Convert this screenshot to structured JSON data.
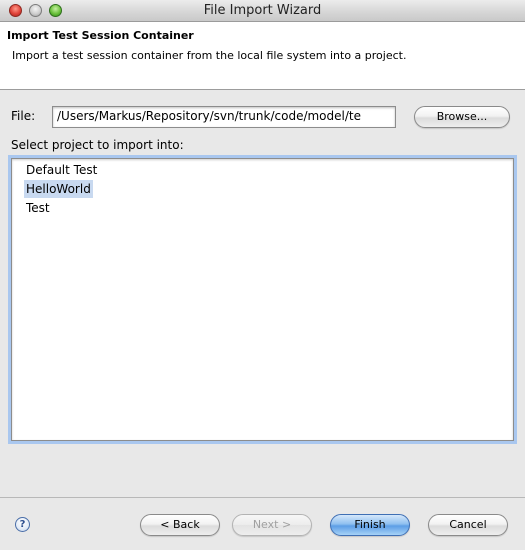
{
  "window": {
    "title": "File Import Wizard"
  },
  "banner": {
    "title": "Import Test Session Container",
    "description": "Import a test session container from the local file system into a project."
  },
  "file": {
    "label": "File:",
    "value": "/Users/Markus/Repository/svn/trunk/code/model/te",
    "browse_label": "Browse..."
  },
  "projects": {
    "label": "Select project to import into:",
    "items": [
      {
        "label": "Default Test",
        "selected": false
      },
      {
        "label": "HelloWorld",
        "selected": true
      },
      {
        "label": "Test",
        "selected": false
      }
    ]
  },
  "footer": {
    "help_icon": "?",
    "back_label": "< Back",
    "next_label": "Next >",
    "finish_label": "Finish",
    "cancel_label": "Cancel"
  },
  "colors": {
    "selection": "#c8d9f0",
    "default_button": "#5d9ee6",
    "focus_ring": "#a9c7ef"
  }
}
